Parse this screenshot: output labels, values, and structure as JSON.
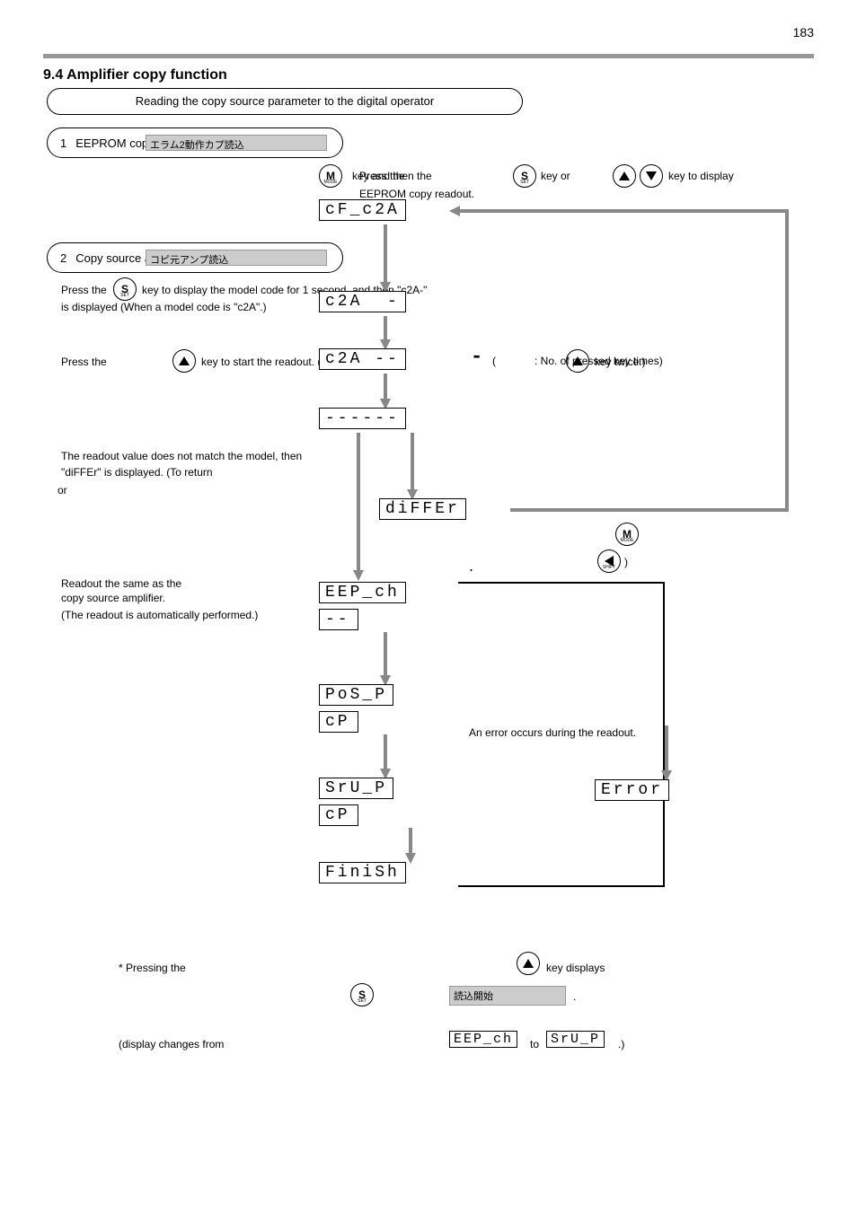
{
  "page_number": "183",
  "section_title": "9.4 Amplifier copy function",
  "legend": "Reading the copy source parameter to the digital operator",
  "step1": {
    "num": "1",
    "label": "EEPROM copy readout"
  },
  "step1_shade": "エラム2動作カプ読込",
  "step1_instr_a": "Press the ",
  "step1_instr_b": " key and then the ",
  "step1_instr_c": " key or ",
  "step1_instr_d": " key to display",
  "step1_line2": "EEPROM copy readout.",
  "step2": {
    "num": "2",
    "label": "Copy source amplifier readout"
  },
  "step2_shade": "コピ元アンプ読込",
  "step2_a": "Press the ",
  "step2_b": " key to display the model code for 1 second, and then \"c2A-\"",
  "step2_c": "is displayed (When a model code is \"c2A\".)",
  "step2_d": "Press the ",
  "step2_e": " key to start the readout.    (Example: press ",
  "step2_f": " key twice.)",
  "text_before_readout": "The readout value does not match the model, then",
  "text_differ": "\"diFFEr\" is displayed. (To return ",
  "text_or": "or ",
  "lcd": {
    "cf_c2a": "cF_c2A",
    "c2a1": "c2A  -",
    "c2a2": "c2A --",
    "dashes": "------",
    "differ": "diFFEr",
    "eep_ch": "EEP_ch",
    "dash2": "--",
    "pos_p": "PoS_P",
    "cp1": "cP",
    "sru_p": "SrU_P",
    "cp2": "cP",
    "finish": "FiniSh",
    "error": "Error",
    "eep_ch_small": "EEP_ch",
    "sru_p_small": "SrU_P"
  },
  "readout_label1": "Readout the same as the",
  "readout_label2": "copy source amplifier.",
  "readout_note": "(The readout is automatically performed.)",
  "error_label": "An error occurs during the readout.",
  "arrow_note_a": "( ",
  "arrow_note_b": " : No. of pressed key times)",
  "start_box_label": "読込開始",
  "bottom_a": "Pressing the ",
  "bottom_b": " key displays ",
  "bottom_c": ".",
  "bottom2_a": "(display changes from ",
  "bottom2_b": " to ",
  "bottom2_c": " .)"
}
